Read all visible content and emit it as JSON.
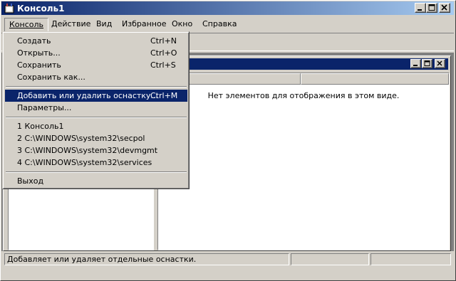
{
  "window": {
    "title": "Консоль1",
    "icon": "mmc-console-icon"
  },
  "menubar": {
    "items": [
      {
        "label": "Консоль",
        "accel_index": 0
      },
      {
        "label": "Действие",
        "accel_index": 0
      },
      {
        "label": "Вид",
        "accel_index": 0
      },
      {
        "label": "Избранное",
        "accel_index": 0
      },
      {
        "label": "Окно",
        "accel_index": 0
      },
      {
        "label": "Справка",
        "accel_index": 0
      }
    ]
  },
  "console_menu": {
    "items": [
      {
        "label": "Создать",
        "shortcut": "Ctrl+N"
      },
      {
        "label": "Открыть...",
        "shortcut": "Ctrl+O"
      },
      {
        "label": "Сохранить",
        "shortcut": "Ctrl+S"
      },
      {
        "label": "Сохранить как...",
        "shortcut": ""
      },
      {
        "label": "Добавить или удалить оснастку...",
        "shortcut": "Ctrl+M",
        "highlighted": true
      },
      {
        "label": "Параметры...",
        "shortcut": ""
      },
      {
        "label": "1 Консоль1",
        "shortcut": ""
      },
      {
        "label": "2 C:\\WINDOWS\\system32\\secpol",
        "shortcut": ""
      },
      {
        "label": "3 C:\\WINDOWS\\system32\\devmgmt",
        "shortcut": ""
      },
      {
        "label": "4 C:\\WINDOWS\\system32\\services",
        "shortcut": ""
      },
      {
        "label": "Выход",
        "shortcut": ""
      }
    ]
  },
  "result_pane": {
    "empty_message": "Нет элементов для отображения в этом виде."
  },
  "statusbar": {
    "text": "Добавляет или удаляет отдельные оснастки."
  },
  "colors": {
    "face": "#d4d0c8",
    "title_active": "#0a246a",
    "highlight": "#0a246a",
    "shadow": "#808080"
  }
}
